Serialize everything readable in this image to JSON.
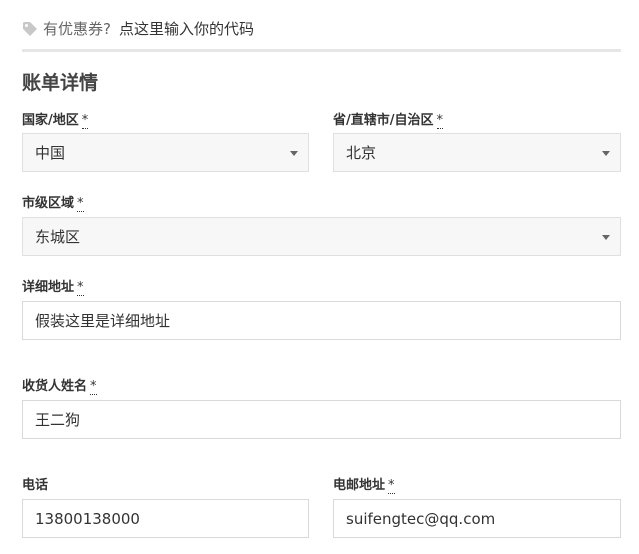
{
  "coupon": {
    "question": "有优惠券?",
    "link": "点这里输入你的代码"
  },
  "billing": {
    "title": "账单详情",
    "required_mark": "*",
    "country": {
      "label": "国家/地区",
      "value": "中国"
    },
    "province": {
      "label": "省/直辖市/自治区",
      "value": "北京"
    },
    "district": {
      "label": "市级区域",
      "value": "东城区"
    },
    "address": {
      "label": "详细地址",
      "value": "假装这里是详细地址"
    },
    "name": {
      "label": "收货人姓名",
      "value": "王二狗"
    },
    "phone": {
      "label": "电话",
      "value": "13800138000"
    },
    "email": {
      "label": "电邮地址",
      "value": "suifengtec@qq.com"
    }
  }
}
